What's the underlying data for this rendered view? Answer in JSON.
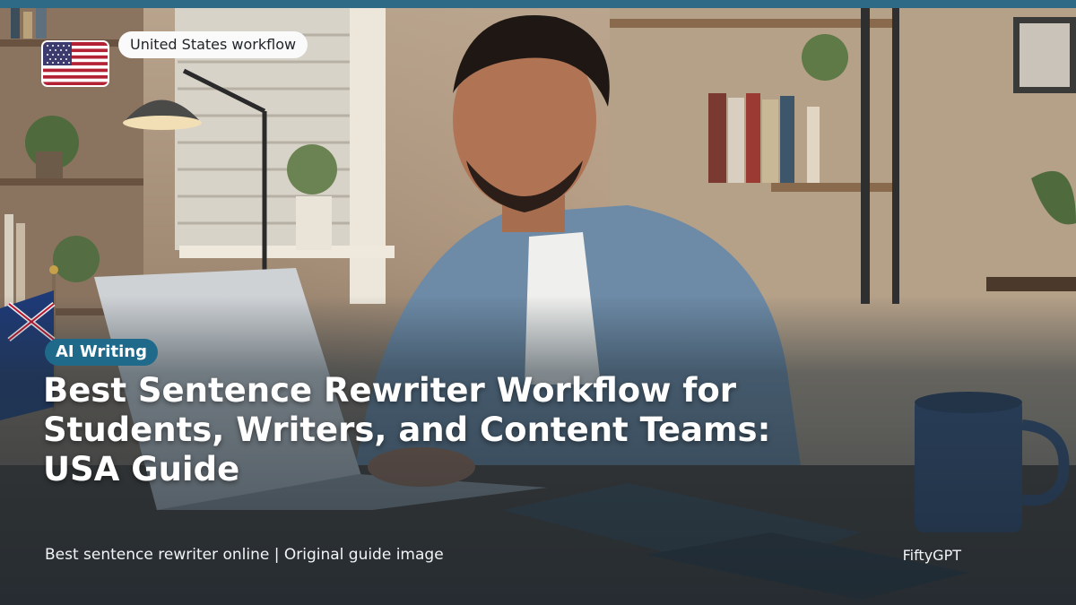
{
  "badge": {
    "country": "United States workflow",
    "flag_icon": "us-flag-icon"
  },
  "article": {
    "category": "AI Writing",
    "title": "Best Sentence Rewriter Workflow for Students, Writers, and Content Teams: USA Guide",
    "caption": "Best sentence rewriter online | Original guide image",
    "brand": "FiftyGPT"
  },
  "colors": {
    "top_bar": "#2e6a86",
    "category_badge": "#1f6a8a",
    "chip_background": "#fafafa",
    "text_light": "#ffffff"
  }
}
